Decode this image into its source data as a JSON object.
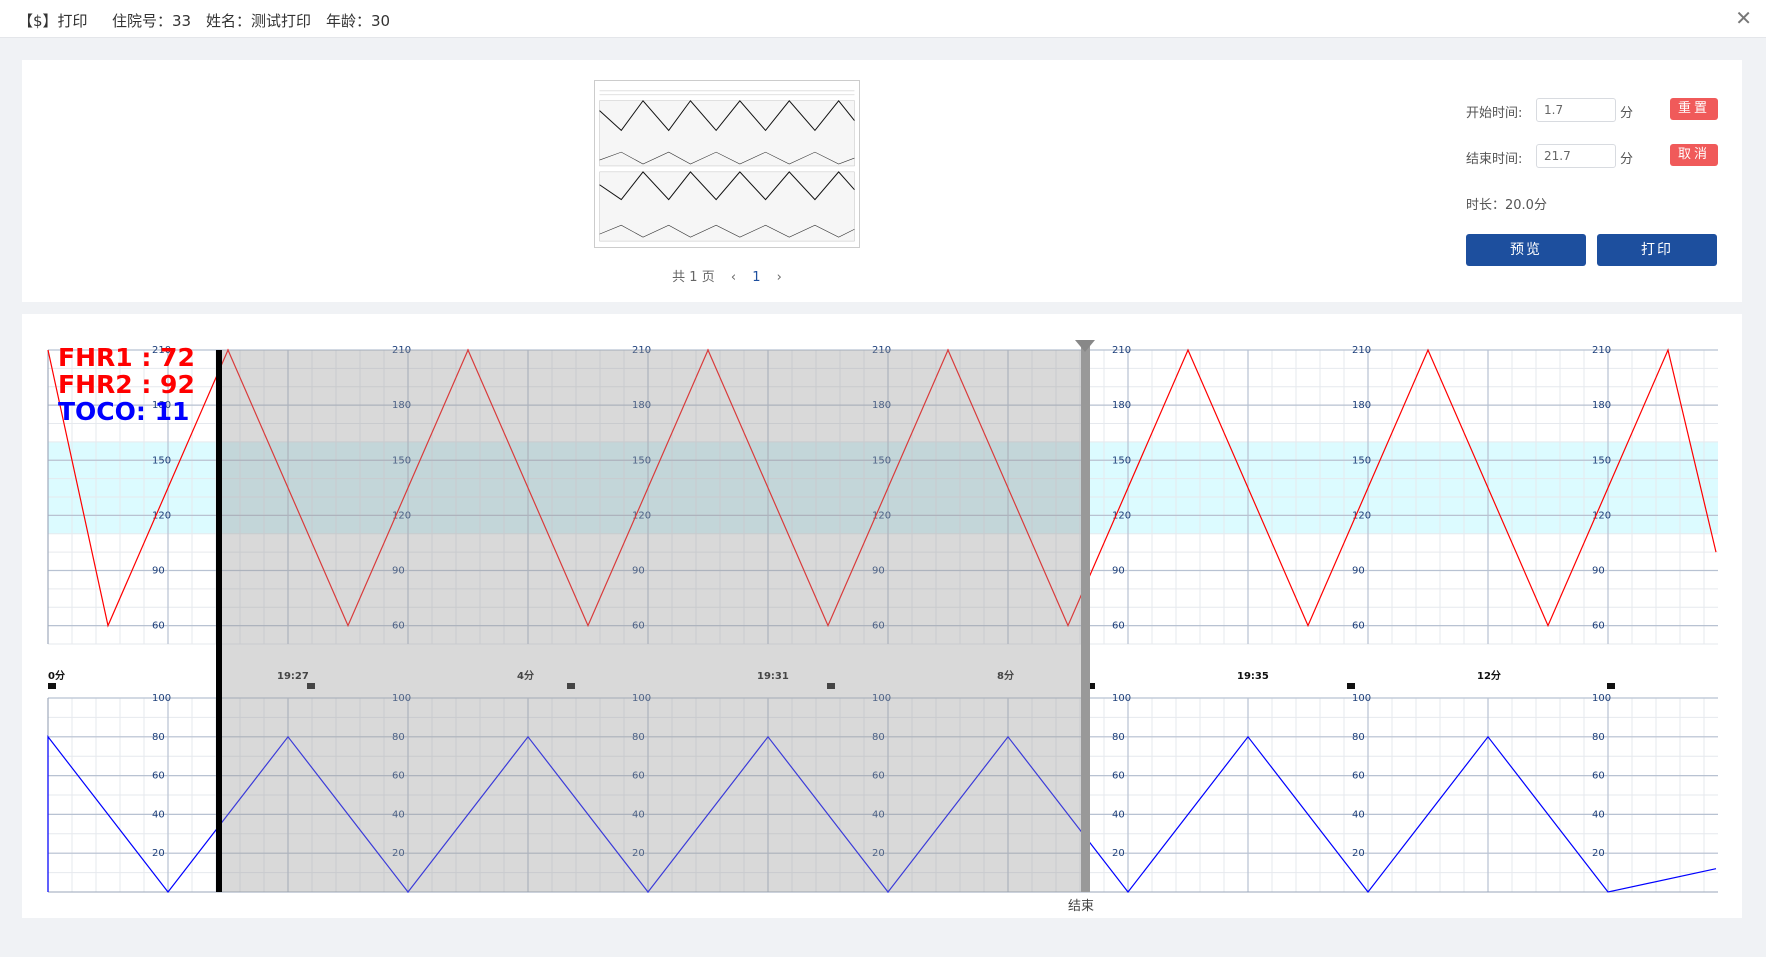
{
  "header": {
    "title": "【$】打印",
    "hospital_no": "住院号：33",
    "name": "姓名：测试打印",
    "age": "年龄：30"
  },
  "preview": {
    "pager_total": "共 1 页",
    "pager_prev": "‹",
    "pager_current": "1",
    "pager_next": "›"
  },
  "settings": {
    "start_label": "开始时间:",
    "start_value": "1.7",
    "start_unit": "分",
    "reset_label": "重置",
    "end_label": "结束时间:",
    "end_value": "21.7",
    "end_unit": "分",
    "cancel_label": "取消",
    "duration": "时长：20.0分",
    "preview_label": "预览",
    "print_label": "打印"
  },
  "chart_data": {
    "type": "line",
    "readouts": [
      {
        "text": "FHR1 : 72",
        "color": "#ff0000"
      },
      {
        "text": "FHR2 : 92",
        "color": "#ff0000"
      },
      {
        "text": "TOCO: 11",
        "color": "#0000ff"
      }
    ],
    "fhr_ticks": [
      "210",
      "180",
      "150",
      "120",
      "90",
      "60"
    ],
    "fhr_ylim": [
      50,
      210
    ],
    "fhr_normal_band": [
      110,
      160
    ],
    "toco_ticks": [
      "100",
      "80",
      "60",
      "40",
      "20"
    ],
    "toco_ylim": [
      0,
      100
    ],
    "time_labels": [
      "0分",
      "19:27",
      "4分",
      "19:31",
      "8分",
      "19:35",
      "12分"
    ],
    "end_marker_label": "结束",
    "fhr_series": {
      "name": "FHR",
      "color": "#ff0000",
      "x_min": [
        0,
        0.5,
        1.5,
        2.5,
        3.5,
        4.5,
        5.5,
        6.5,
        7.5,
        8.5,
        9.5,
        10.5,
        11.5,
        12.5,
        13.5,
        13.9
      ],
      "values": [
        210,
        60,
        210,
        60,
        210,
        60,
        210,
        60,
        210,
        60,
        210,
        60,
        210,
        60,
        210,
        100
      ]
    },
    "toco_series": {
      "name": "TOCO",
      "color": "#0000ff",
      "x_min": [
        0,
        0,
        1,
        2,
        3,
        4,
        5,
        6,
        7,
        8,
        9,
        10,
        11,
        12,
        13,
        13.9
      ],
      "values": [
        0,
        80,
        0,
        80,
        0,
        80,
        0,
        80,
        0,
        80,
        0,
        80,
        0,
        80,
        0,
        12
      ]
    },
    "selection": {
      "start_min": 1.7,
      "end_min": 21.7
    },
    "grid": true
  }
}
